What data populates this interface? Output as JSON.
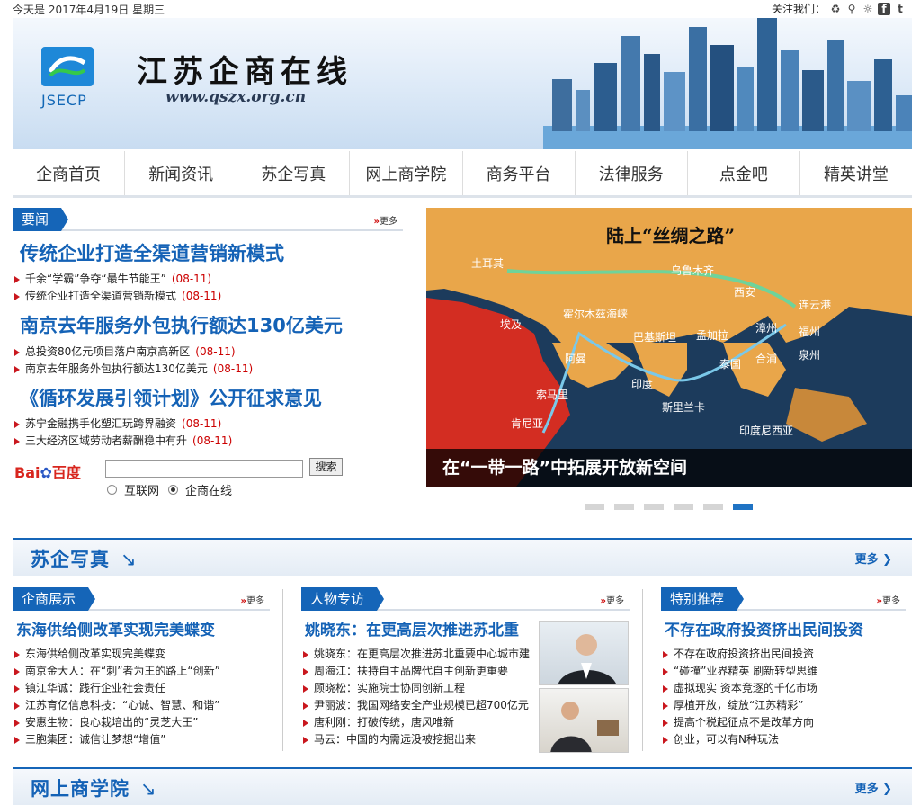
{
  "topbar": {
    "date": "今天是 2017年4月19日 星期三",
    "follow_label": "关注我们："
  },
  "brand": {
    "abbr": "JSECP",
    "title": "江苏企商在线",
    "url": "www.qszx.org.cn"
  },
  "nav": [
    "企商首页",
    "新闻资讯",
    "苏企写真",
    "网上商学院",
    "商务平台",
    "法律服务",
    "点金吧",
    "精英讲堂"
  ],
  "news": {
    "tab": "要闻",
    "more": "更多",
    "groups": [
      {
        "headline": "传统企业打造全渠道营销新模式",
        "items": [
          {
            "text": "千余“学霸”争夺“最牛节能王”",
            "date": "(08-11)"
          },
          {
            "text": "传统企业打造全渠道营销新模式",
            "date": "(08-11)"
          }
        ]
      },
      {
        "headline": "南京去年服务外包执行额达130亿美元",
        "items": [
          {
            "text": "总投资80亿元项目落户南京高新区",
            "date": "(08-11)"
          },
          {
            "text": "南京去年服务外包执行额达130亿美元",
            "date": "(08-11)"
          }
        ]
      },
      {
        "headline": "《循环发展引领计划》公开征求意见",
        "items": [
          {
            "text": "苏宁金融携手化塑汇玩跨界融资",
            "date": "(08-11)"
          },
          {
            "text": "三大经济区域劳动者薪酬稳中有升",
            "date": "(08-11)"
          }
        ]
      }
    ]
  },
  "search": {
    "logo_a": "Bai",
    "logo_b": "百度",
    "button": "搜索",
    "opt1": "互联网",
    "opt2": "企商在线",
    "selected": "企商在线"
  },
  "slide": {
    "map_title": "陆上“丝绸之路”",
    "caption": "在“一带一路”中拓展开放新空间",
    "places": [
      "土耳其",
      "乌鲁木齐",
      "西安",
      "连云港",
      "埃及",
      "霍尔木兹海峡",
      "巴基斯坦",
      "孟加拉",
      "漳州",
      "福州",
      "泉州",
      "阿曼",
      "泰国",
      "合浦",
      "印度",
      "索马里",
      "斯里兰卡",
      "肯尼亚",
      "印度尼西亚"
    ],
    "dots": 6,
    "active_dot": 6
  },
  "band1": {
    "title": "苏企写真",
    "arrow": "↘",
    "more": "更多"
  },
  "band2": {
    "title": "网上商学院",
    "arrow": "↘",
    "more": "更多"
  },
  "col1": {
    "tab": "企商展示",
    "more": "更多",
    "headline": "东海供给侧改革实现完美蝶变",
    "items": [
      "东海供给侧改革实现完美蝶变",
      "南京金大人：在“刺”者为王的路上“创新”",
      "镇江华诚：践行企业社会责任",
      "江苏育亿信息科技：“心诚、智慧、和谐”",
      "安惠生物：良心栽培出的“灵芝大王”",
      "三胞集团：诚信让梦想“增值”"
    ]
  },
  "col2": {
    "tab": "人物专访",
    "more": "更多",
    "headline": "姚晓东：在更高层次推进苏北重",
    "items": [
      "姚晓东：在更高层次推进苏北重要中心城市建",
      "周海江：扶持自主品牌代自主创新更重要",
      "顾晓松：实施院士协同创新工程",
      "尹丽波：我国网络安全产业规模已超700亿元",
      "唐利刚：打破传统，唐风唯新",
      "马云：中国的内需远没被挖掘出来"
    ]
  },
  "col3": {
    "tab": "特别推荐",
    "more": "更多",
    "headline": "不存在政府投资挤出民间投资",
    "items": [
      "不存在政府投资挤出民间投资",
      "“碰撞”业界精英 刷新转型思维",
      "虚拟现实 资本竞逐的千亿市场",
      "厚植开放，绽放“江苏精彩”",
      "提高个税起征点不是改革方向",
      "创业，可以有N种玩法"
    ]
  },
  "colors": {
    "accent": "#1565b8",
    "headline": "#1462b6",
    "date_red": "#cc0000"
  }
}
